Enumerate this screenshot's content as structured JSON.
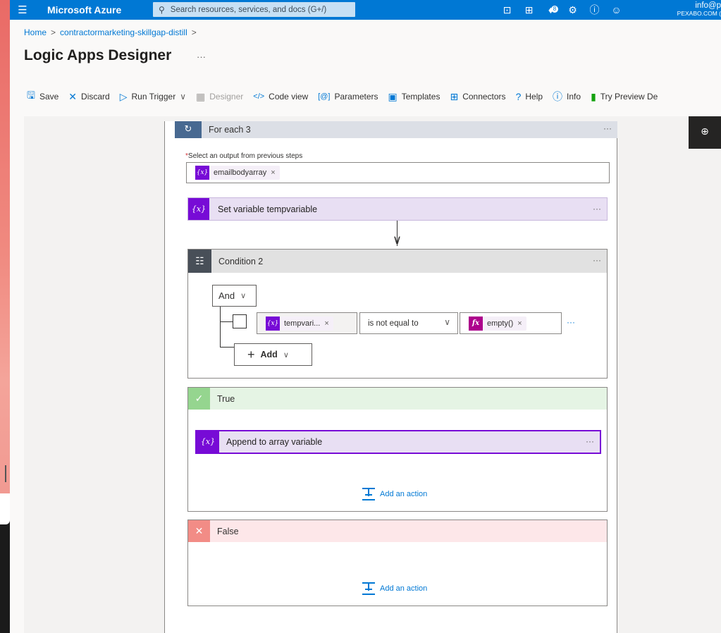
{
  "topbar": {
    "brand": "Microsoft Azure",
    "search_placeholder": "Search resources, services, and docs (G+/)",
    "notification_count": "8",
    "account_user": "info@p",
    "account_tenant": "PEXABO.COM ("
  },
  "breadcrumb": {
    "home": "Home",
    "resource": "contractormarketing-skillgap-distill"
  },
  "page": {
    "title": "Logic Apps Designer",
    "more": "···"
  },
  "toolbar": {
    "save": "Save",
    "discard": "Discard",
    "run_trigger": "Run Trigger",
    "designer": "Designer",
    "code_view": "Code view",
    "parameters": "Parameters",
    "templates": "Templates",
    "connectors": "Connectors",
    "help": "Help",
    "info": "Info",
    "try_preview": "Try Preview De"
  },
  "foreach": {
    "title": "For each 3",
    "more": "···",
    "required_label": "Select an output from previous steps",
    "output_token": "emailbodyarray"
  },
  "set_variable": {
    "title": "Set variable tempvariable",
    "more": "···"
  },
  "condition": {
    "title": "Condition 2",
    "more": "···",
    "group_operator": "And",
    "left_operand": "tempvari...",
    "operator": "is not equal to",
    "right_operand": "empty()",
    "row_more": "···",
    "add_label": "Add"
  },
  "true_branch": {
    "title": "True",
    "action_title": "Append to array variable",
    "action_more": "···",
    "add_action": "Add an action"
  },
  "false_branch": {
    "title": "False",
    "add_action": "Add an action"
  },
  "colors": {
    "azure_blue": "#0078d4",
    "variable_purple": "#770bd6",
    "expression_magenta": "#ad008c",
    "true_green": "#95d58f",
    "false_red": "#f28c86"
  }
}
